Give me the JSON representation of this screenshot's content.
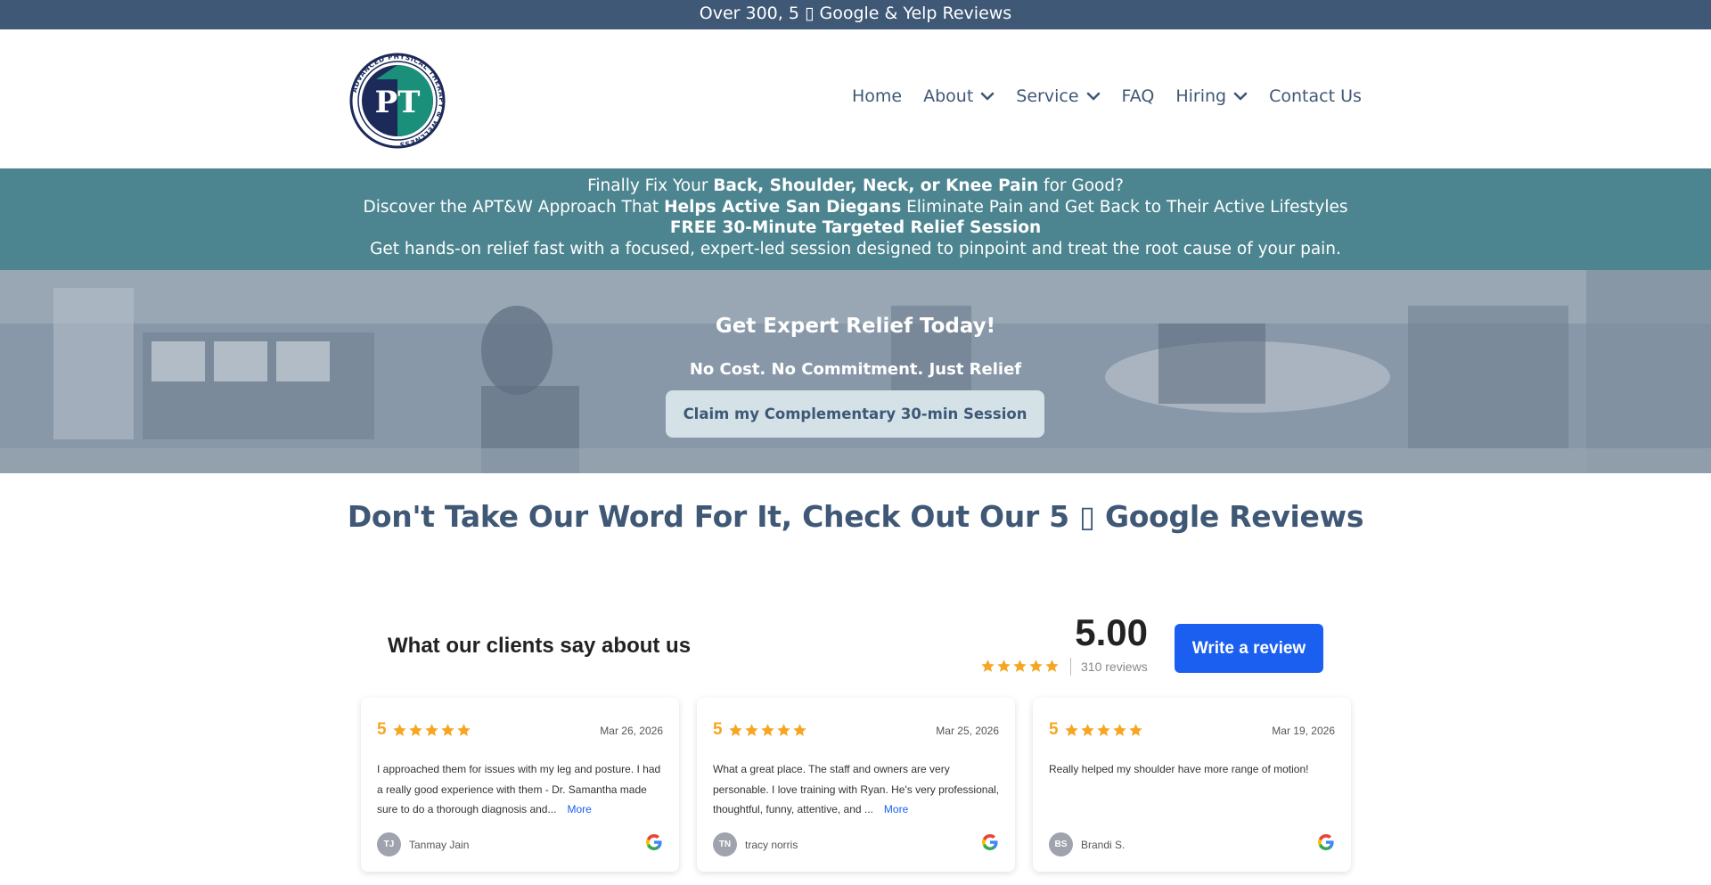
{
  "topbar": {
    "text": "Over 300, 5 ▯ Google & Yelp Reviews"
  },
  "nav": {
    "home": "Home",
    "about": "About",
    "service": "Service",
    "faq": "FAQ",
    "hiring": "Hiring",
    "contact": "Contact Us"
  },
  "logo": {
    "ring_text": "ADVANCED PHYSICAL THERAPY & WELLNESS",
    "letters": "PT"
  },
  "promo": {
    "line1_pre": "Finally Fix Your ",
    "line1_bold": "Back, Shoulder, Neck, or Knee Pain",
    "line1_post": " for Good?",
    "line2_pre": "Discover the APT&W Approach That ",
    "line2_bold": "Helps Active San Diegans",
    "line2_post": " Eliminate Pain and Get Back to Their Active Lifestyles",
    "line3": "FREE 30-Minute Targeted Relief Session",
    "line4": "Get hands-on relief fast with a focused, expert-led session designed to pinpoint and treat the root cause of your pain."
  },
  "hero": {
    "title": "Get Expert Relief Today!",
    "subtitle": "No Cost. No Commitment. Just Relief",
    "cta": "Claim my Complementary 30-min Session"
  },
  "reviews_heading": "Don't Take Our Word For It, Check Out Our 5 ▯ Google Reviews",
  "widget": {
    "title": "What our clients say about us",
    "rating": "5.00",
    "rating_stars": 5,
    "count": "310 reviews",
    "write_button": "Write a review",
    "more_label": "More",
    "reviews": [
      {
        "score": "5",
        "stars": 5,
        "date": "Mar 26, 2026",
        "text": "I approached them for issues with my leg and posture. I had a really good experience with them - Dr. Samantha made sure to do a thorough diagnosis and...",
        "has_more": true,
        "initials": "TJ",
        "author": "Tanmay Jain"
      },
      {
        "score": "5",
        "stars": 5,
        "date": "Mar 25, 2026",
        "text": "What a great place. The staff and owners are very personable. I love training with Ryan. He's very professional, thoughtful, funny, attentive, and ...",
        "has_more": true,
        "initials": "TN",
        "author": "tracy norris"
      },
      {
        "score": "5",
        "stars": 5,
        "date": "Mar 19, 2026",
        "text": "Really helped my shoulder have more range of motion!",
        "has_more": false,
        "initials": "BS",
        "author": "Brandi S."
      }
    ]
  },
  "colors": {
    "brand_navy": "#3f5876",
    "promo_teal": "#4c8590",
    "star_gold": "#f5a623",
    "cta_blue": "#1a5ff0"
  }
}
